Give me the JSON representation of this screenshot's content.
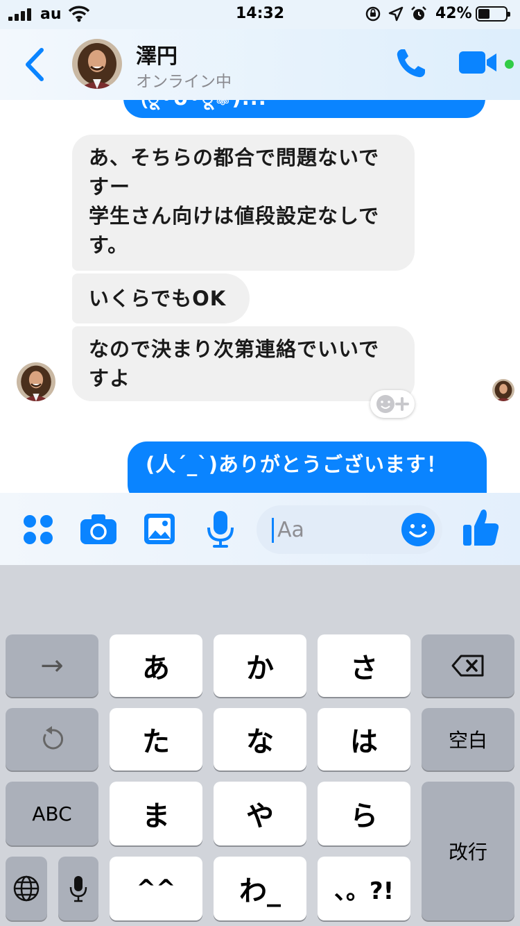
{
  "status_bar": {
    "carrier": "au",
    "time": "14:32",
    "battery": "42%",
    "battery_fraction": 0.42
  },
  "header": {
    "name": "澤円",
    "status": "オンライン中"
  },
  "messages": [
    {
      "dir": "out",
      "text": "(ू•ᴗ•ू❁)..."
    },
    {
      "dir": "in",
      "lines": [
        "あ、そちらの都合で問題ないで",
        "すー",
        "学生さん向けは値段設定なしで",
        "す。"
      ]
    },
    {
      "dir": "in",
      "text": "いくらでもOK"
    },
    {
      "dir": "in",
      "lines": [
        "なので決まり次第連絡でいいで",
        "すよ"
      ]
    },
    {
      "dir": "out",
      "text": "(人´_`)ありがとうございます！"
    }
  ],
  "composer": {
    "placeholder": "Aa"
  },
  "keyboard": {
    "arrow": "→",
    "a": "あ",
    "ka": "か",
    "sa": "さ",
    "ta": "た",
    "na": "な",
    "ha": "は",
    "space": "空白",
    "abc": "ABC",
    "ma": "ま",
    "ya": "や",
    "ra": "ら",
    "enter": "改行",
    "face": "^^",
    "wa": "わ_",
    "punct": "、。?!"
  },
  "colors": {
    "accent": "#0a84ff",
    "online": "#31cc46",
    "bubble_in": "#f0f0f0",
    "keyboard_bg": "#d1d4da"
  },
  "icons": [
    "back-chevron-icon",
    "phone-icon",
    "video-camera-icon",
    "apps-grid-icon",
    "camera-icon",
    "gallery-icon",
    "microphone-icon",
    "emoji-icon",
    "thumbs-up-icon",
    "backspace-icon",
    "undo-icon",
    "globe-icon"
  ]
}
